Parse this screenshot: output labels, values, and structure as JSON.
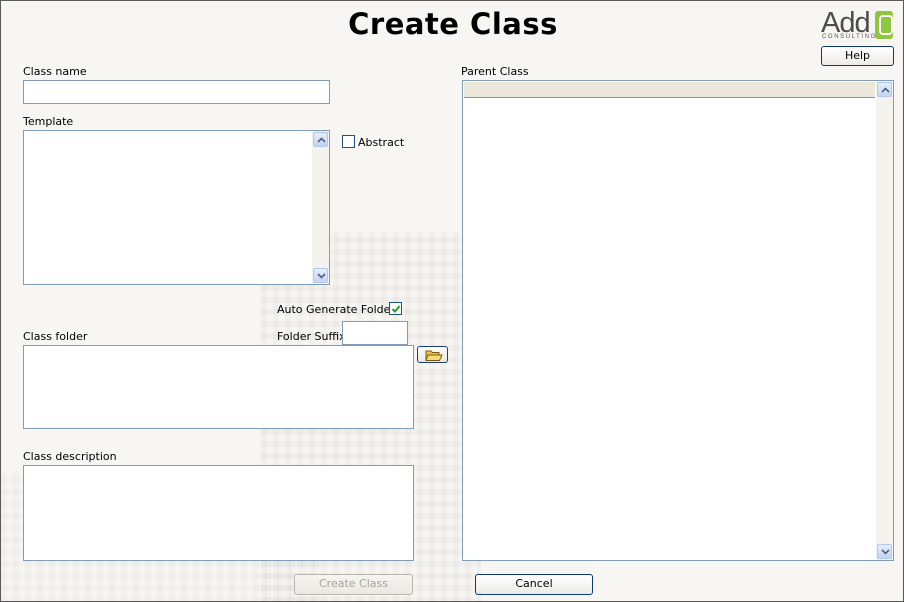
{
  "title": "Create Class",
  "logo": {
    "text": "Add",
    "sub": "CONSULTING",
    "accent": "#8dc63f"
  },
  "help_label": "Help",
  "class_name": {
    "label": "Class name",
    "value": ""
  },
  "template": {
    "label": "Template",
    "value": ""
  },
  "abstract": {
    "label": "Abstract",
    "checked": false
  },
  "auto_generate": {
    "label": "Auto Generate Folder",
    "checked": true
  },
  "folder_suffix": {
    "label": "Folder Suffix",
    "value": ""
  },
  "class_folder": {
    "label": "Class folder",
    "value": ""
  },
  "class_description": {
    "label": "Class description",
    "value": ""
  },
  "parent_class": {
    "label": "Parent Class"
  },
  "buttons": {
    "create": "Create Class",
    "cancel": "Cancel"
  },
  "colors": {
    "field_border": "#7f9db9",
    "button_border": "#0f3a7a",
    "checkmark": "#21a121"
  }
}
